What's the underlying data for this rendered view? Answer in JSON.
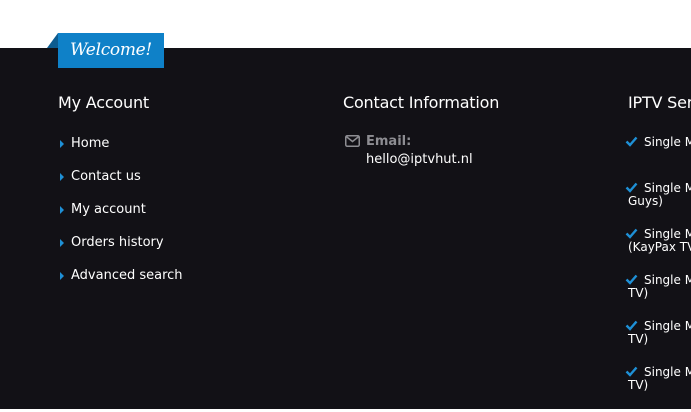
{
  "welcome": {
    "label": "Welcome!"
  },
  "account": {
    "title": "My Account",
    "links": [
      "Home",
      "Contact us",
      "My account",
      "Orders history",
      "Advanced search"
    ]
  },
  "contact": {
    "title": "Contact Information",
    "email_label": "Email:",
    "email_value": "hello@iptvhut.nl"
  },
  "services": {
    "title": "IPTV Serv",
    "items": [
      "Single M",
      "Single M Guys)",
      "Single M (KayPax TV",
      "Single M TV)",
      "Single M TV)",
      "Single M TV)"
    ]
  },
  "colors": {
    "background": "#121116",
    "accent": "#0f81c8",
    "arrow": "#1e90d6",
    "check": "#1e90d6"
  },
  "icons": {
    "mail": "envelope-icon",
    "arrow": "caret-right-icon",
    "check": "checkmark-icon"
  }
}
